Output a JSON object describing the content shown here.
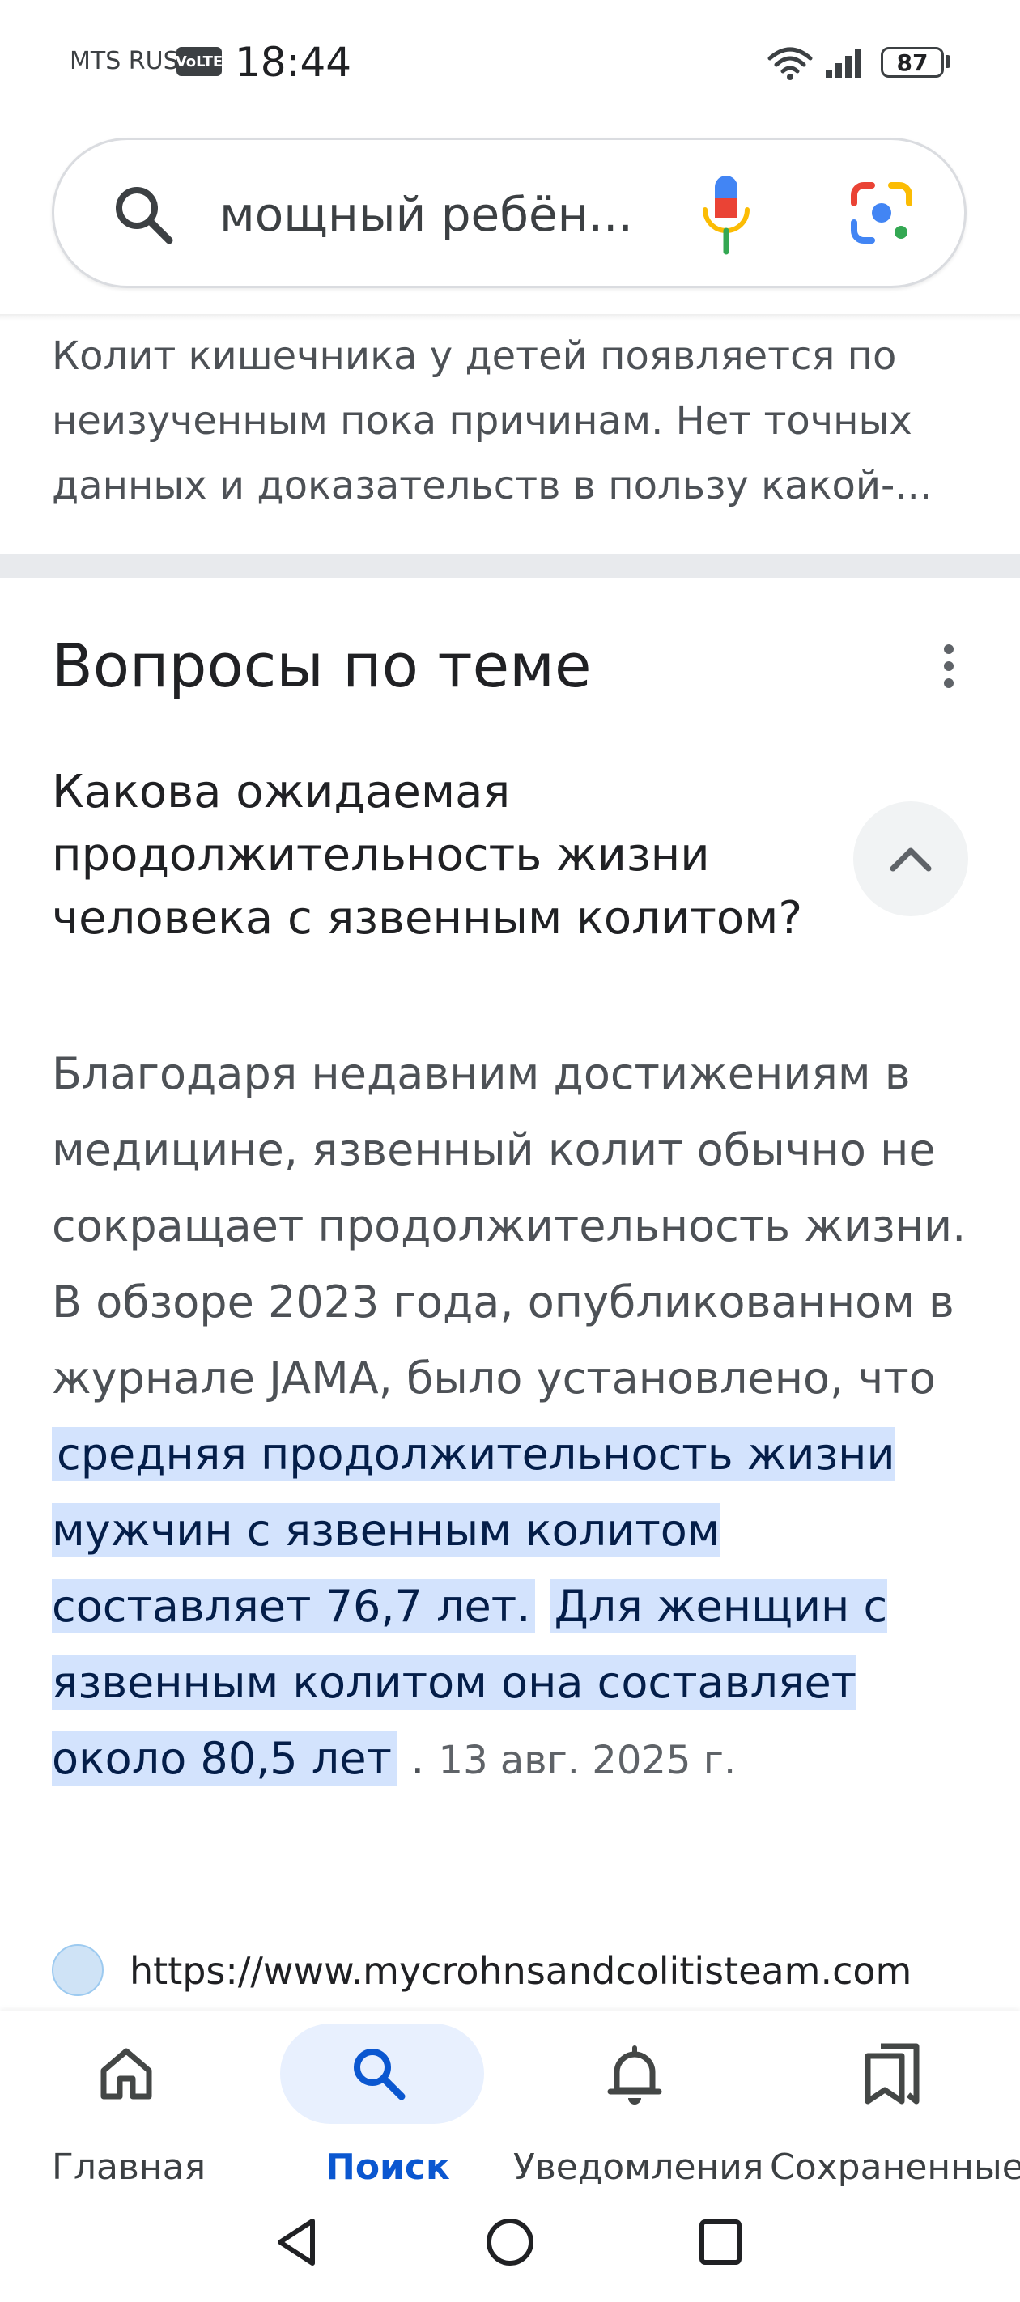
{
  "status_bar": {
    "carrier": "MTS RUS",
    "volte": "VoLTE",
    "time": "18:44",
    "battery": "87"
  },
  "search": {
    "query": "мощный ребён..."
  },
  "snippet": {
    "text": "Колит кишечника у детей появляется по неизученным пока причинам. Нет точных данных и доказательств в пользу какой-..."
  },
  "related_questions": {
    "title": "Вопросы по теме",
    "question": "Какова ожидаемая продолжительность жизни человека с язвенным колитом?",
    "answer_plain": "Благодаря недавним достижениям в медицине, язвенный колит обычно не сокращает продолжительность жизни. В обзоре 2023 года, опубликованном в журнале JAMA, было установлено, что ",
    "answer_highlight_1": "средняя продолжительность жизни мужчин с язвенным колитом составляет 76,7 лет.",
    "answer_highlight_2": "Для женщин с язвенным колитом она составляет около 80,5 лет",
    "answer_date": "13 авг. 2025 г.",
    "source_url": "https://www.mycrohnsandcolitisteam.com"
  },
  "bottom_nav": {
    "items": [
      {
        "label": "Главная",
        "icon": "home-icon"
      },
      {
        "label": "Поиск",
        "icon": "search-icon",
        "active": true
      },
      {
        "label": "Уведомления",
        "icon": "bell-icon"
      },
      {
        "label": "Сохраненные",
        "icon": "bookmarks-icon"
      }
    ]
  },
  "colors": {
    "accent": "#0b57d0",
    "highlight": "#d3e3fd",
    "active_pill": "#e8f0fe"
  }
}
